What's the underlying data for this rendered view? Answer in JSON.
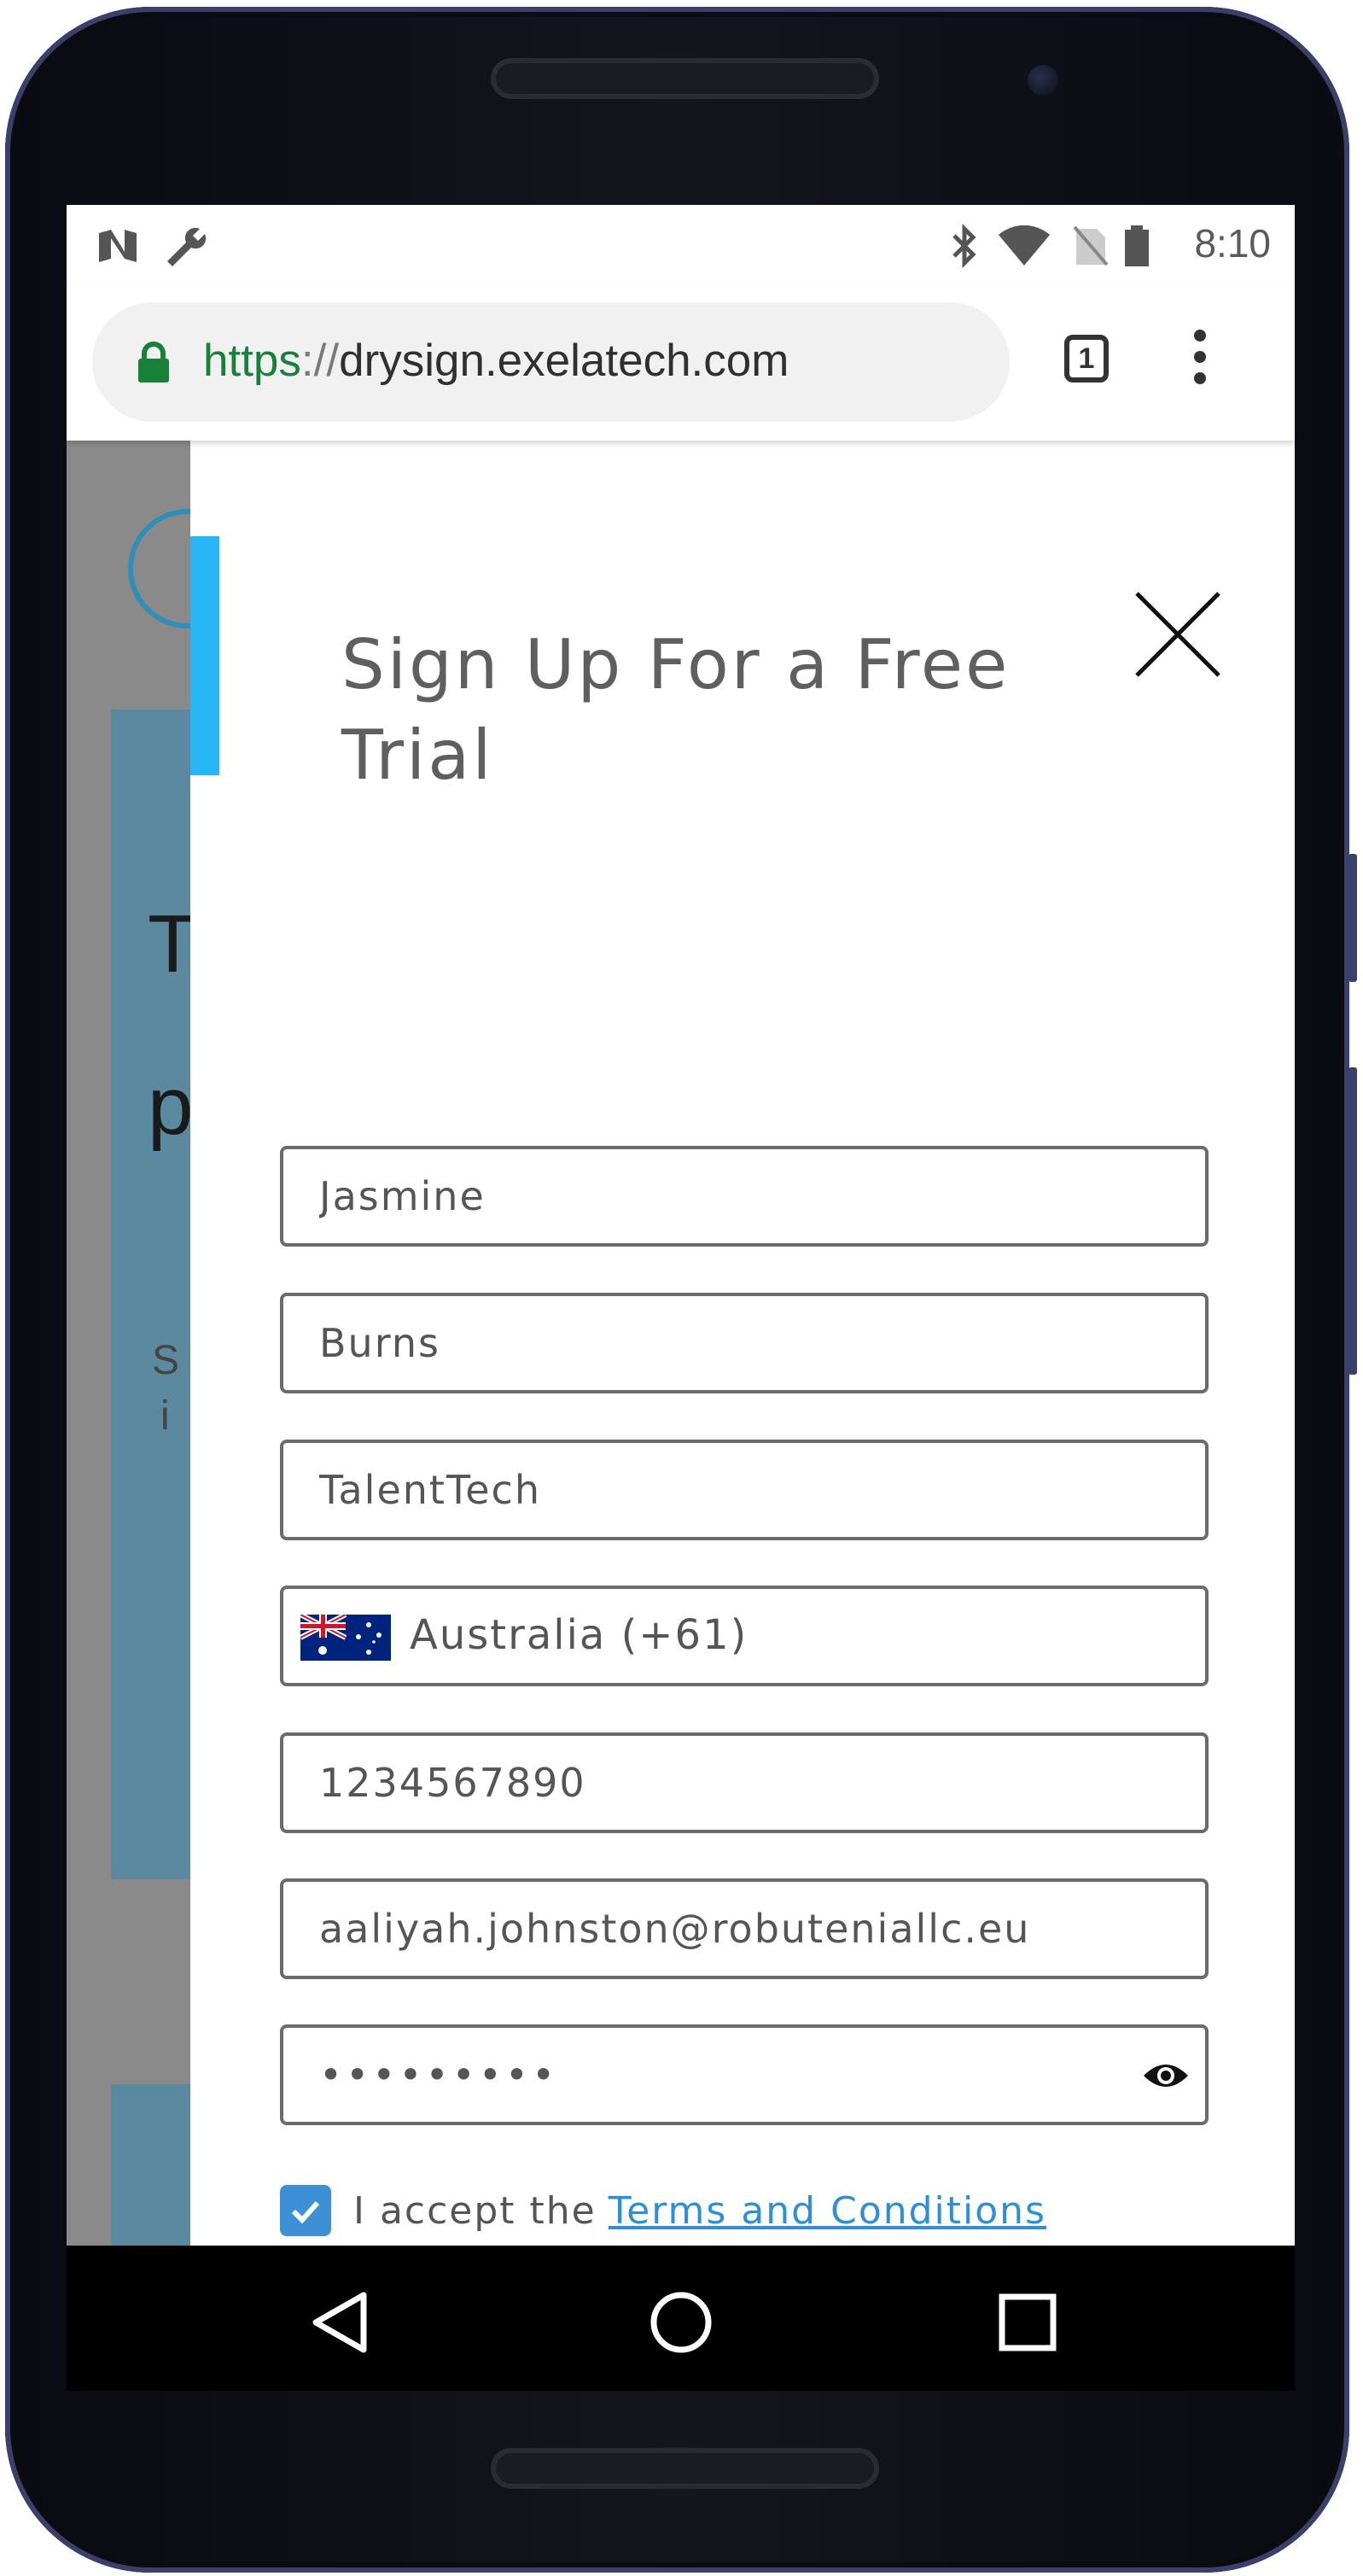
{
  "status_bar": {
    "time": "8:10",
    "left_icons": [
      "n-notification-icon",
      "wrench-icon"
    ],
    "right_icons": [
      "bluetooth-icon",
      "wifi-icon",
      "no-sim-icon",
      "battery-icon"
    ]
  },
  "browser": {
    "url_scheme": "https",
    "url_separator": "://",
    "url_host": "drysign.exelatech.com",
    "tab_count": "1"
  },
  "background_page": {
    "letters": [
      "T",
      "p",
      "S",
      "i"
    ]
  },
  "form": {
    "title": "Sign Up For a Free Trial",
    "fields": {
      "first_name": "Jasmine",
      "last_name": "Burns",
      "company": "TalentTech",
      "country": "Australia (+61)",
      "phone": "1234567890",
      "email": "aaliyah.johnston@robuteniallc.eu",
      "password": "•••••••••"
    },
    "terms_prefix": "I accept the",
    "terms_link": "Terms and Conditions",
    "terms_checked": true
  },
  "colors": {
    "accent": "#29b6f6",
    "link": "#2d8fd6",
    "checkbox": "#3d8fd6"
  }
}
